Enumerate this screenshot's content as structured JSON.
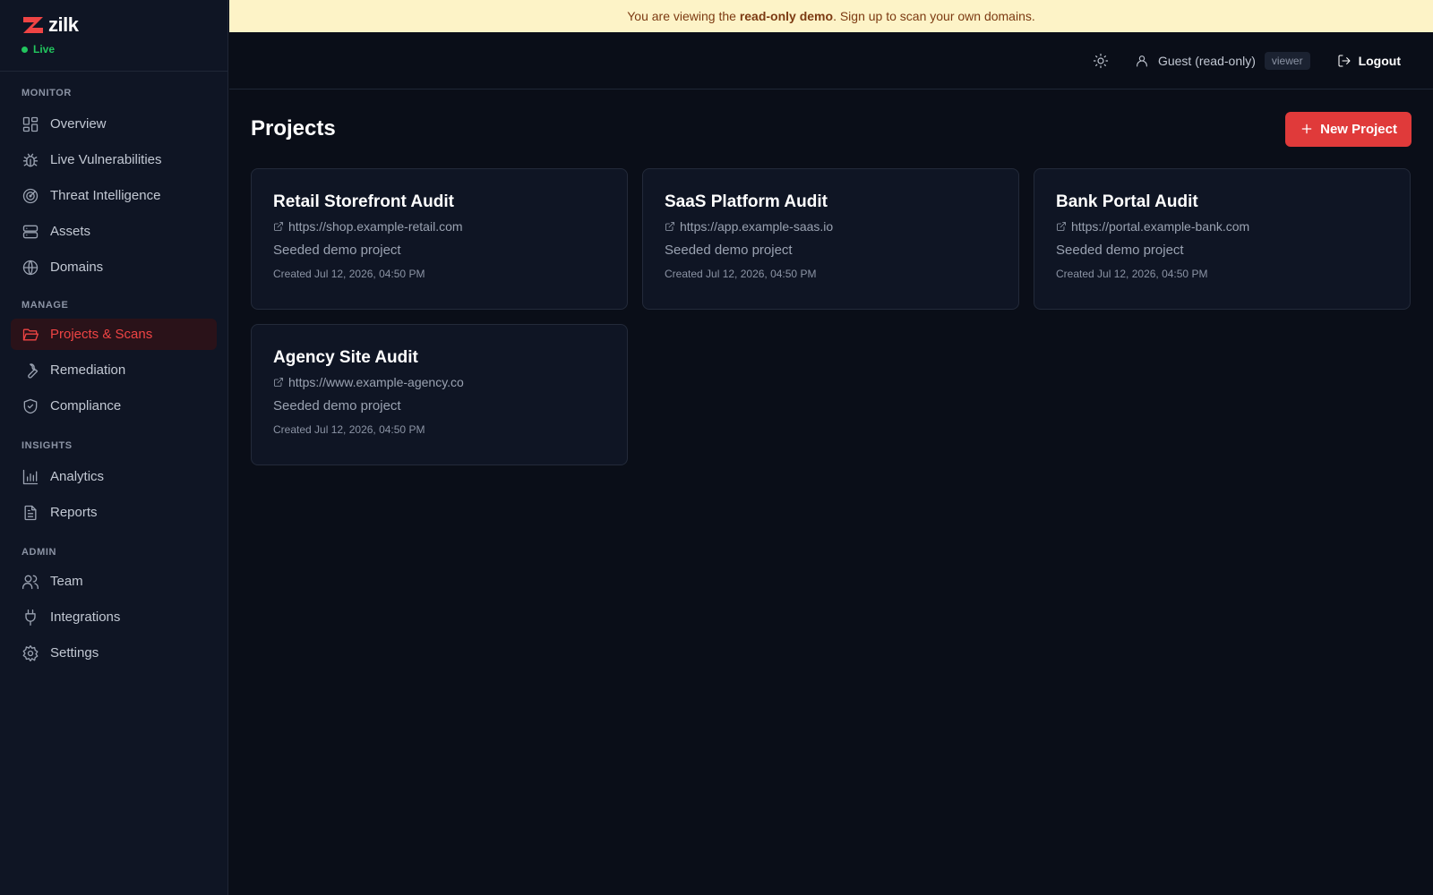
{
  "brand": {
    "name": "zilk",
    "status": "Live"
  },
  "banner": {
    "prefix": "You are viewing the ",
    "emphasis": "read-only demo",
    "suffix": ". Sign up to scan your own domains."
  },
  "sidebar": {
    "sections": [
      {
        "title": "MONITOR",
        "items": [
          {
            "label": "Overview",
            "icon": "grid-icon"
          },
          {
            "label": "Live Vulnerabilities",
            "icon": "bug-icon"
          },
          {
            "label": "Threat Intelligence",
            "icon": "radar-icon"
          },
          {
            "label": "Assets",
            "icon": "server-icon"
          },
          {
            "label": "Domains",
            "icon": "globe-icon"
          }
        ]
      },
      {
        "title": "MANAGE",
        "items": [
          {
            "label": "Projects & Scans",
            "icon": "folder-icon",
            "active": true
          },
          {
            "label": "Remediation",
            "icon": "wrench-icon"
          },
          {
            "label": "Compliance",
            "icon": "shield-icon"
          }
        ]
      },
      {
        "title": "INSIGHTS",
        "items": [
          {
            "label": "Analytics",
            "icon": "bar-chart-icon"
          },
          {
            "label": "Reports",
            "icon": "file-icon"
          }
        ]
      },
      {
        "title": "ADMIN",
        "items": [
          {
            "label": "Team",
            "icon": "users-icon"
          },
          {
            "label": "Integrations",
            "icon": "plug-icon"
          },
          {
            "label": "Settings",
            "icon": "gear-icon"
          }
        ]
      }
    ]
  },
  "header": {
    "user": "Guest (read-only)",
    "role": "viewer",
    "logout": "Logout"
  },
  "main": {
    "title": "Projects",
    "new_button": "New Project",
    "projects": [
      {
        "name": "Retail Storefront Audit",
        "url": "https://shop.example-retail.com",
        "description": "Seeded demo project",
        "created": "Created Jul 12, 2026, 04:50 PM"
      },
      {
        "name": "SaaS Platform Audit",
        "url": "https://app.example-saas.io",
        "description": "Seeded demo project",
        "created": "Created Jul 12, 2026, 04:50 PM"
      },
      {
        "name": "Bank Portal Audit",
        "url": "https://portal.example-bank.com",
        "description": "Seeded demo project",
        "created": "Created Jul 12, 2026, 04:50 PM"
      },
      {
        "name": "Agency Site Audit",
        "url": "https://www.example-agency.co",
        "description": "Seeded demo project",
        "created": "Created Jul 12, 2026, 04:50 PM"
      }
    ]
  },
  "colors": {
    "accent": "#e03a3a",
    "live": "#22c55e",
    "banner_bg": "#fdf3c7",
    "banner_text": "#7c3a12"
  }
}
